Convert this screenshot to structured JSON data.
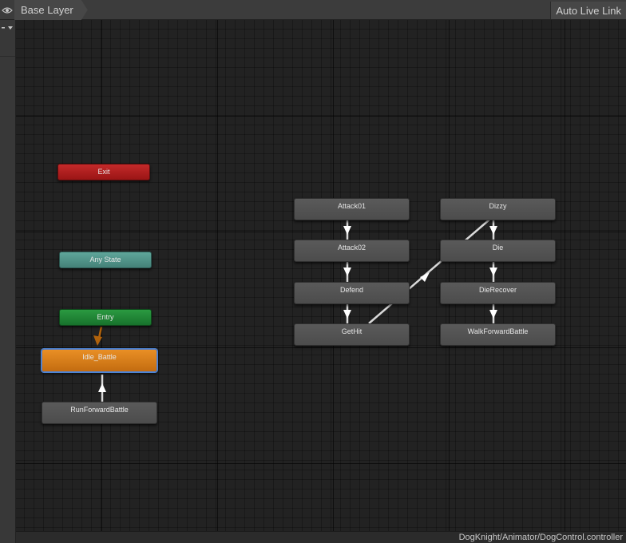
{
  "toolbar": {
    "layer_name": "Base Layer",
    "auto_live_link_label": "Auto Live Link",
    "eye_icon": "eye-icon"
  },
  "side_panel": {
    "dropdown_icon": "menu-dropdown-icon"
  },
  "graph": {
    "states": {
      "exit": "Exit",
      "any_state": "Any State",
      "entry": "Entry",
      "idle_battle": "Idle_Battle",
      "run_forward_battle": "RunForwardBattle",
      "attack01": "Attack01",
      "attack02": "Attack02",
      "defend": "Defend",
      "gethit": "GetHit",
      "dizzy": "Dizzy",
      "die": "Die",
      "die_recover": "DieRecover",
      "walk_forward_battle": "WalkForwardBattle"
    },
    "default_state": "Idle_Battle",
    "colors": {
      "exit": "#b01e1e",
      "any_state": "#559488",
      "entry": "#208537",
      "default_state": "#d87d1a",
      "state": "#535353",
      "transition": "#d9d9d9",
      "entry_transition": "#b0620c"
    },
    "transitions": [
      {
        "from": "Entry",
        "to": "Idle_Battle"
      },
      {
        "from": "RunForwardBattle",
        "to": "Idle_Battle"
      },
      {
        "from": "Attack01",
        "to": "Attack02"
      },
      {
        "from": "Attack02",
        "to": "Defend"
      },
      {
        "from": "Defend",
        "to": "GetHit"
      },
      {
        "from": "GetHit",
        "to": "Dizzy"
      },
      {
        "from": "Dizzy",
        "to": "Die"
      },
      {
        "from": "Die",
        "to": "DieRecover"
      },
      {
        "from": "DieRecover",
        "to": "WalkForwardBattle"
      }
    ]
  },
  "status_bar": {
    "controller_path": "DogKnight/Animator/DogControl.controller"
  }
}
